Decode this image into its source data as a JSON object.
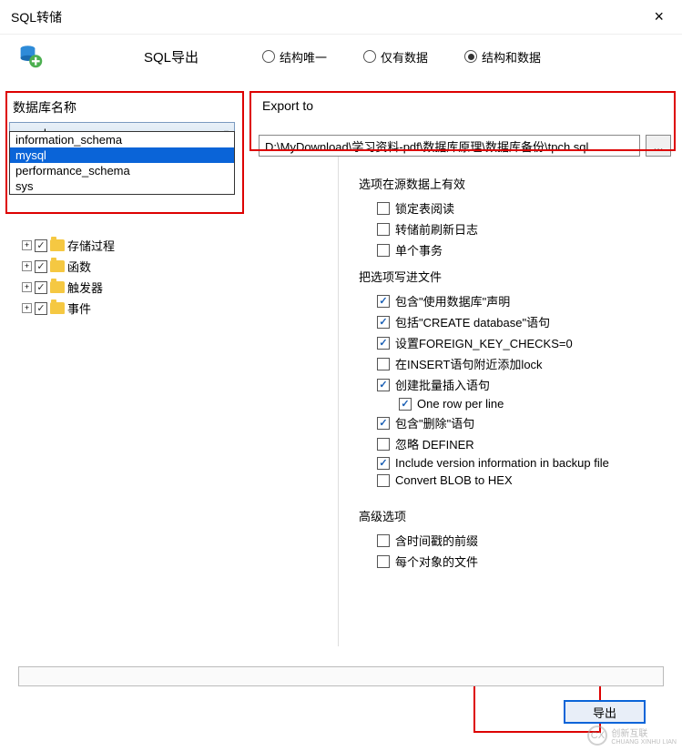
{
  "title": "SQL转储",
  "toolbar": {
    "sql_export_label": "SQL导出"
  },
  "radios": {
    "structure_only": "结构唯一",
    "data_only": "仅有数据",
    "structure_and_data": "结构和数据",
    "selected": "structure_and_data"
  },
  "left": {
    "label": "数据库名称",
    "combo_value": "mysql",
    "dropdown_items": [
      "information_schema",
      "mysql",
      "performance_schema",
      "sys"
    ],
    "dropdown_selected": "mysql",
    "tree": [
      {
        "label": "存储过程",
        "checked": true
      },
      {
        "label": "函数",
        "checked": true
      },
      {
        "label": "触发器",
        "checked": true
      },
      {
        "label": "事件",
        "checked": true
      }
    ]
  },
  "right": {
    "export_to_label": "Export to",
    "export_path": "D:\\MyDownload\\学习资料-pdf\\数据库原理\\数据库备份\\tpch.sql",
    "browse": "...",
    "group1_label": "选项在源数据上有效",
    "group1": [
      {
        "label": "锁定表阅读",
        "checked": false
      },
      {
        "label": "转储前刷新日志",
        "checked": false
      },
      {
        "label": "单个事务",
        "checked": false
      }
    ],
    "group2_label": "把选项写进文件",
    "group2": [
      {
        "label": "包含\"使用数据库\"声明",
        "checked": true
      },
      {
        "label": "包括\"CREATE database\"语句",
        "checked": true
      },
      {
        "label": "设置FOREIGN_KEY_CHECKS=0",
        "checked": true
      },
      {
        "label": "在INSERT语句附近添加lock",
        "checked": false
      },
      {
        "label": "创建批量插入语句",
        "checked": true
      },
      {
        "label": "One row per line",
        "checked": true,
        "indent": true
      },
      {
        "label": "包含\"删除\"语句",
        "checked": true
      },
      {
        "label": "忽略 DEFINER",
        "checked": false
      },
      {
        "label": "Include version information in backup file",
        "checked": true
      },
      {
        "label": "Convert BLOB to HEX",
        "checked": false
      }
    ],
    "group3_label": "高级选项",
    "group3": [
      {
        "label": "含时间戳的前缀",
        "checked": false
      },
      {
        "label": "每个对象的文件",
        "checked": false
      }
    ]
  },
  "buttons": {
    "export": "导出"
  },
  "watermark": {
    "text": "创新互联",
    "sub": "CHUANG XINHU LIAN"
  }
}
